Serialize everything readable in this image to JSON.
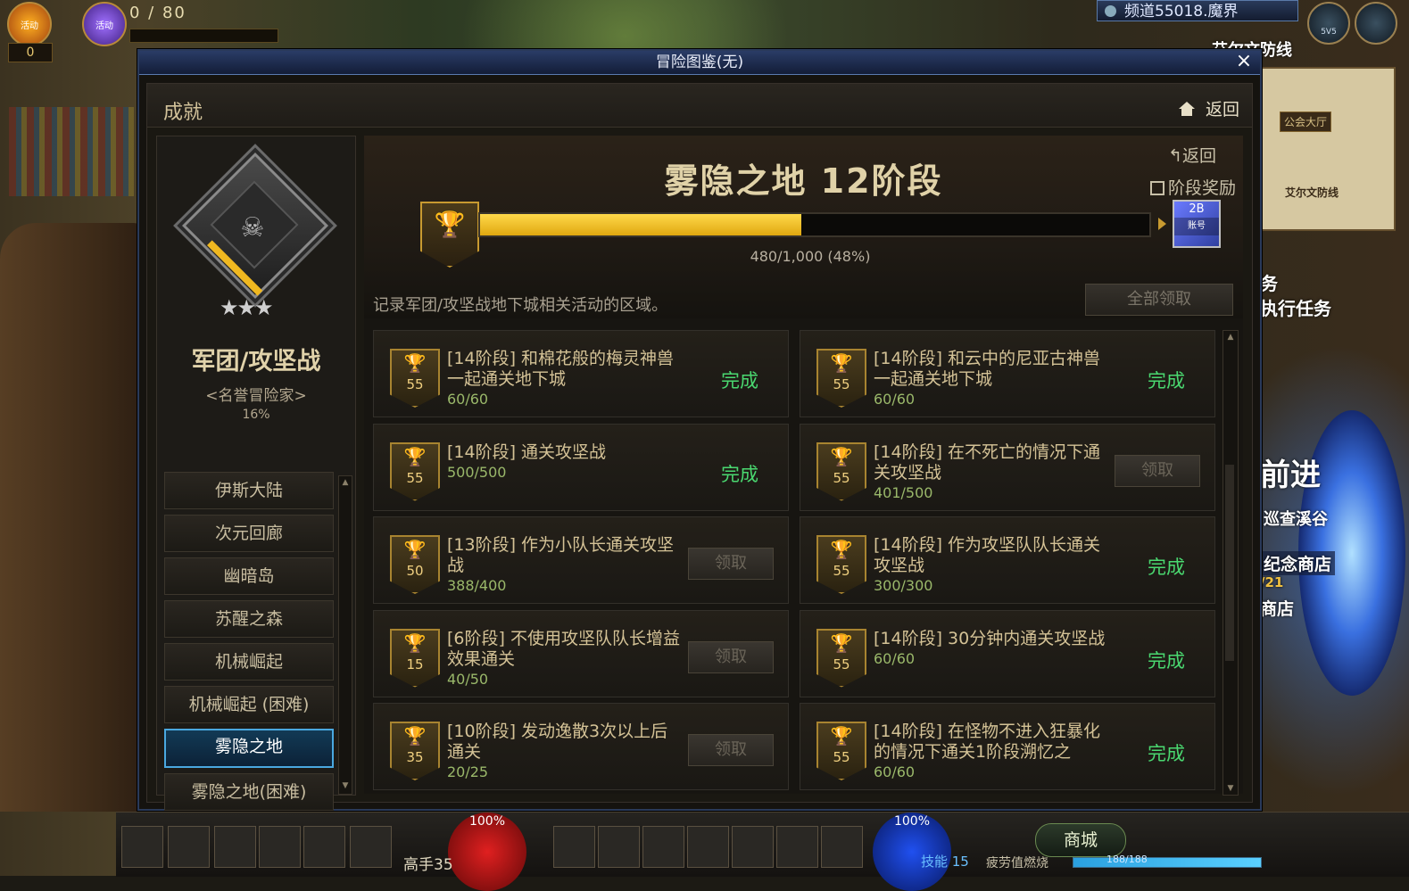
{
  "hud": {
    "orb1_label": "活动",
    "orb2_label": "活动",
    "gold_count": "0",
    "fatigue_text": "0 / 80",
    "channel": "频道55018.魔界",
    "pvp_label": "5V5",
    "partial_dungeon": "艾尔文防线",
    "map_guild": "公会大厅",
    "map_town": "艾尔文防线",
    "side_task1": "务",
    "side_task2": "执行任务",
    "side_advance": "前进",
    "side_area": "巡查溪谷",
    "side_shop": "纪念商店",
    "side_shop_date": "/21",
    "side_shop2": "商店"
  },
  "window": {
    "title": "冒险图鉴(无)",
    "close": "×",
    "section_title": "成就",
    "back_label": "返回"
  },
  "category": {
    "name": "军团/攻坚战",
    "subtitle": "<名誉冒险家>",
    "percent": "16%",
    "stars": "★★★"
  },
  "nav": {
    "items": [
      {
        "label": "伊斯大陆"
      },
      {
        "label": "次元回廊"
      },
      {
        "label": "幽暗岛"
      },
      {
        "label": "苏醒之森"
      },
      {
        "label": "机械崛起"
      },
      {
        "label": "机械崛起 (困难)"
      },
      {
        "label": "雾隐之地",
        "selected": true
      },
      {
        "label": "雾隐之地(困难)"
      }
    ]
  },
  "stage": {
    "title": "雾隐之地 12阶段",
    "back_label": "返回",
    "reward_label": "阶段奖励",
    "progress_text": "480/1,000 (48%)",
    "progress_value": 0.48,
    "reward_item_top": "2B",
    "reward_item_bottom": "账号",
    "description": "记录军团/攻坚战地下城相关活动的区域。",
    "claim_all": "全部领取"
  },
  "achievements": [
    {
      "title": "[14阶段] 和棉花般的梅灵神兽一起通关地下城",
      "progress": "60/60",
      "points": "55",
      "status": "完成"
    },
    {
      "title": "[14阶段] 和云中的尼亚古神兽一起通关地下城",
      "progress": "60/60",
      "points": "55",
      "status": "完成"
    },
    {
      "title": "[14阶段] 通关攻坚战",
      "progress": "500/500",
      "points": "55",
      "status": "完成"
    },
    {
      "title": "[14阶段] 在不死亡的情况下通关攻坚战",
      "progress": "401/500",
      "points": "55",
      "status": "领取"
    },
    {
      "title": "[13阶段] 作为小队长通关攻坚战",
      "progress": "388/400",
      "points": "50",
      "status": "领取"
    },
    {
      "title": "[14阶段] 作为攻坚队队长通关攻坚战",
      "progress": "300/300",
      "points": "55",
      "status": "完成"
    },
    {
      "title": "[6阶段] 不使用攻坚队队长增益效果通关",
      "progress": "40/50",
      "points": "15",
      "status": "领取"
    },
    {
      "title": "[14阶段] 30分钟内通关攻坚战",
      "progress": "60/60",
      "points": "55",
      "status": "完成"
    },
    {
      "title": "[10阶段] 发动逸散3次以上后通关",
      "progress": "20/25",
      "points": "35",
      "status": "领取"
    },
    {
      "title": "[14阶段] 在怪物不进入狂暴化的情况下通关1阶段溯忆之",
      "progress": "60/60",
      "points": "55",
      "status": "完成"
    }
  ],
  "bottom": {
    "hp": "100%",
    "mp": "100%",
    "level": "高手35",
    "shop": "商城",
    "skill": "技能 15",
    "fatigue": "疲劳值燃烧",
    "exp": "188/188"
  },
  "colors": {
    "progress_fill": "#f0b820",
    "complete_green": "#4ad870",
    "selected_nav": "#4aa8e0"
  }
}
